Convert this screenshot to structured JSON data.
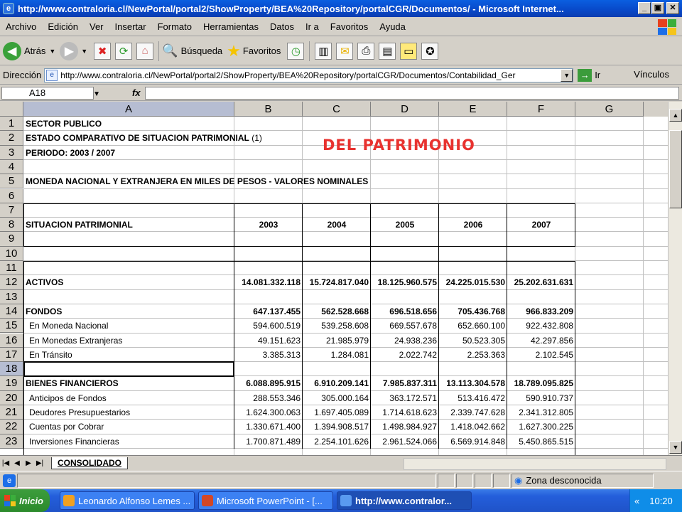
{
  "window": {
    "title": "http://www.contraloria.cl/NewPortal/portal2/ShowProperty/BEA%20Repository/portalCGR/Documentos/ - Microsoft Internet..."
  },
  "menu": [
    "Archivo",
    "Edición",
    "Ver",
    "Insertar",
    "Formato",
    "Herramientas",
    "Datos",
    "Ir a",
    "Favoritos",
    "Ayuda"
  ],
  "toolbar": {
    "back_label": "Atrás",
    "search_label": "Búsqueda",
    "favorites_label": "Favoritos"
  },
  "address": {
    "label": "Dirección",
    "url": "http://www.contraloria.cl/NewPortal/portal2/ShowProperty/BEA%20Repository/portalCGR/Documentos/Contabilidad_Ger",
    "go_label": "Ir",
    "links_label": "Vínculos"
  },
  "formula_bar": {
    "cell_ref": "A18",
    "fx": "fx",
    "content": ""
  },
  "columns": [
    "A",
    "B",
    "C",
    "D",
    "E",
    "F",
    "G"
  ],
  "rows": [
    "1",
    "2",
    "3",
    "4",
    "5",
    "6",
    "7",
    "8",
    "9",
    "10",
    "11",
    "12",
    "13",
    "14",
    "15",
    "16",
    "17",
    "18",
    "19",
    "20",
    "21",
    "22",
    "23"
  ],
  "overlay_title": "DEL PATRIMONIO",
  "sheet": {
    "r1": "SECTOR PUBLICO",
    "r2a": "ESTADO COMPARATIVO DE SITUACION PATRIMONIAL",
    "r2b": " (1)",
    "r3": "PERIODO:  2003 / 2007",
    "r5": "MONEDA NACIONAL Y EXTRANJERA EN MILES DE PESOS - VALORES NOMINALES",
    "r8": "SITUACION PATRIMONIAL",
    "years": [
      "2003",
      "2004",
      "2005",
      "2006",
      "2007"
    ],
    "data": [
      {
        "label": "ACTIVOS",
        "bold": true,
        "values": [
          "14.081.332.118",
          "15.724.817.040",
          "18.125.960.575",
          "24.225.015.530",
          "25.202.631.631"
        ]
      },
      {
        "label": "FONDOS",
        "bold": true,
        "values": [
          "647.137.455",
          "562.528.668",
          "696.518.656",
          "705.436.768",
          "966.833.209"
        ]
      },
      {
        "label": "En Moneda Nacional",
        "bold": false,
        "values": [
          "594.600.519",
          "539.258.608",
          "669.557.678",
          "652.660.100",
          "922.432.808"
        ]
      },
      {
        "label": "En Monedas Extranjeras",
        "bold": false,
        "values": [
          "49.151.623",
          "21.985.979",
          "24.938.236",
          "50.523.305",
          "42.297.856"
        ]
      },
      {
        "label": "En Tránsito",
        "bold": false,
        "values": [
          "3.385.313",
          "1.284.081",
          "2.022.742",
          "2.253.363",
          "2.102.545"
        ]
      },
      {
        "label": "BIENES FINANCIEROS",
        "bold": true,
        "values": [
          "6.088.895.915",
          "6.910.209.141",
          "7.985.837.311",
          "13.113.304.578",
          "18.789.095.825"
        ]
      },
      {
        "label": "Anticipos de Fondos",
        "bold": false,
        "values": [
          "288.553.346",
          "305.000.164",
          "363.172.571",
          "513.416.472",
          "590.910.737"
        ]
      },
      {
        "label": "Deudores Presupuestarios",
        "bold": false,
        "values": [
          "1.624.300.063",
          "1.697.405.089",
          "1.714.618.623",
          "2.339.747.628",
          "2.341.312.805"
        ]
      },
      {
        "label": "Cuentas por Cobrar",
        "bold": false,
        "values": [
          "1.330.671.400",
          "1.394.908.517",
          "1.498.984.927",
          "1.418.042.662",
          "1.627.300.225"
        ]
      },
      {
        "label": "Inversiones Financieras",
        "bold": false,
        "values": [
          "1.700.871.489",
          "2.254.101.626",
          "2.961.524.066",
          "6.569.914.848",
          "5.450.865.515"
        ]
      }
    ]
  },
  "sheet_tab": "CONSOLIDADO",
  "status": {
    "zone": "Zona desconocida"
  },
  "taskbar": {
    "start": "Inicio",
    "tasks": [
      "Leonardo Alfonso Lemes ...",
      "Microsoft PowerPoint - [...",
      "http://www.contralor..."
    ],
    "clock": "10:20",
    "tray_arrows": "«"
  },
  "colors": {
    "overlay": "#e8322f",
    "title_bar": "#0848c8",
    "taskbar": "#245edb"
  }
}
